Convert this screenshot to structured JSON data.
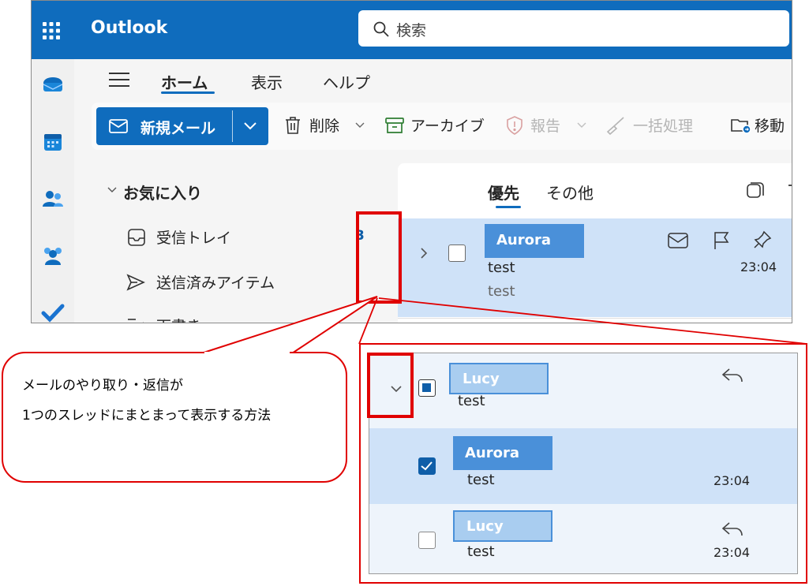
{
  "app": {
    "title": "Outlook"
  },
  "search": {
    "placeholder": "検索"
  },
  "ribbon": {
    "tabs": [
      "ホーム",
      "表示",
      "ヘルプ"
    ]
  },
  "toolbar": {
    "new_mail": "新規メール",
    "delete": "削除",
    "archive": "アーカイブ",
    "report": "報告",
    "sweep": "一括処理",
    "move": "移動"
  },
  "folders": {
    "favorites": "お気に入り",
    "inbox": "受信トレイ",
    "inbox_count": "3",
    "sent": "送信済みアイテム",
    "drafts": "下書き"
  },
  "list": {
    "tab_focused": "優先",
    "tab_other": "その他",
    "row": {
      "sender": "Aurora",
      "subject": "test",
      "preview": "test",
      "time": "23:04"
    }
  },
  "callout": {
    "line1": "メールのやり取り・返信が",
    "line2": "1つのスレッドにまとまって表示する方法"
  },
  "thread": {
    "header": {
      "sender": "Lucy",
      "subject": "test"
    },
    "items": [
      {
        "sender": "Aurora",
        "subject": "test",
        "time": "23:04"
      },
      {
        "sender": "Lucy",
        "subject": "test",
        "time": "23:04"
      }
    ]
  },
  "colors": {
    "brand": "#0f6cbd",
    "highlight": "#e00000",
    "selected_row": "#cfe2f8"
  }
}
